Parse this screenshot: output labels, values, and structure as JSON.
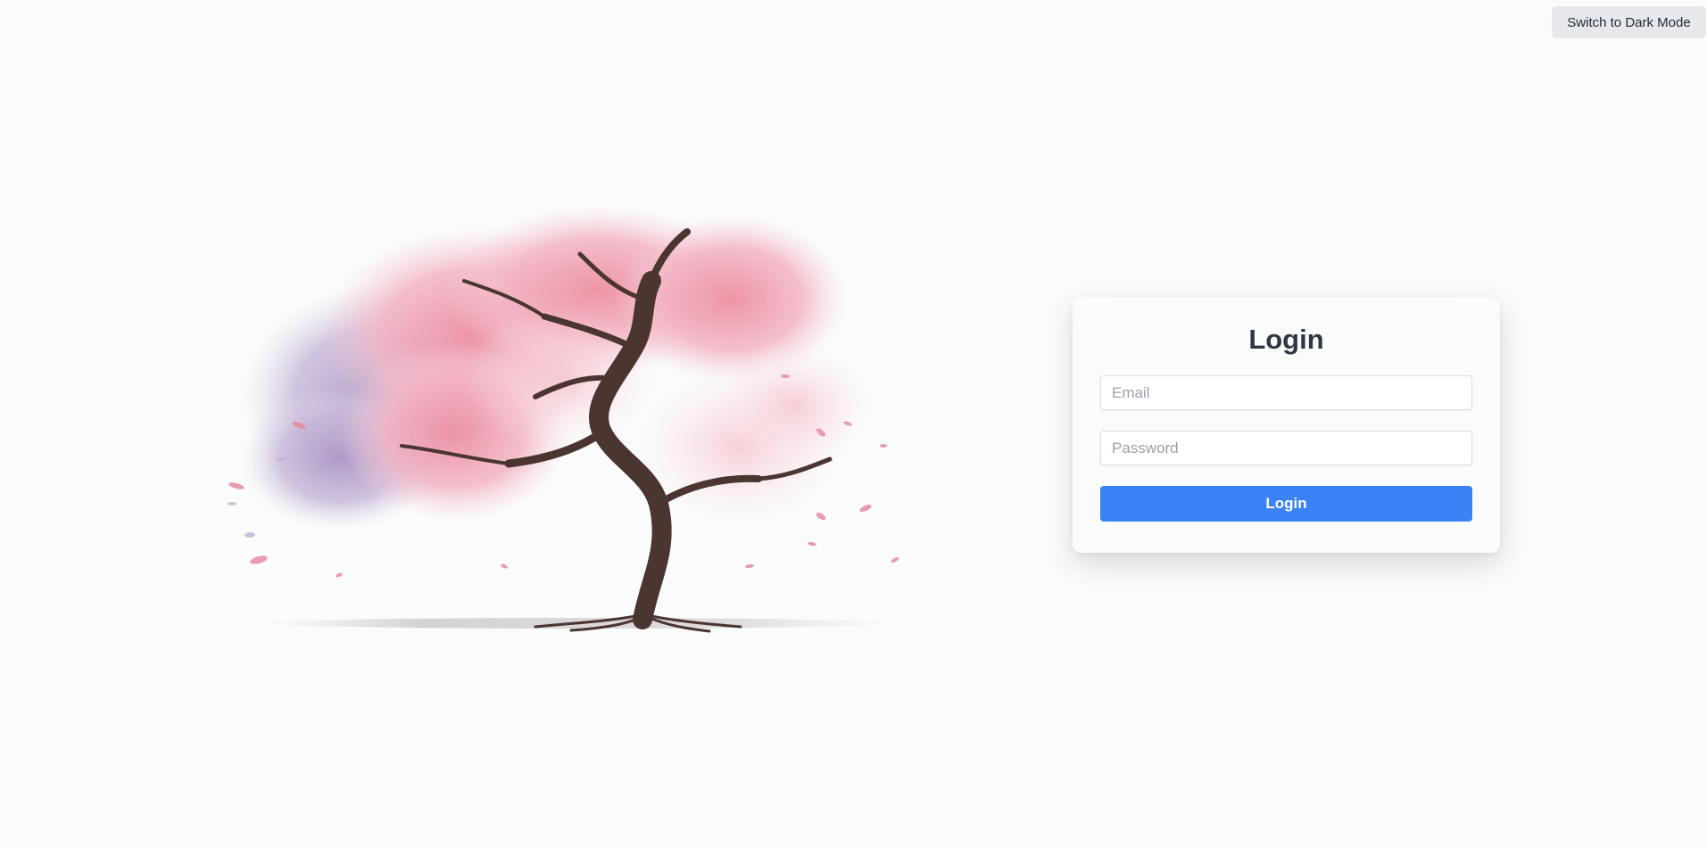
{
  "header": {
    "theme_toggle_label": "Switch to Dark Mode"
  },
  "hero": {
    "image": "cherry-blossom-tree-illustration"
  },
  "login": {
    "title": "Login",
    "email_placeholder": "Email",
    "email_value": "",
    "password_placeholder": "Password",
    "password_value": "",
    "submit_label": "Login"
  },
  "colors": {
    "background": "#fafcfb",
    "accent": "#3b82f6",
    "title_text": "#2d3748",
    "toggle_bg": "#e6e8ec",
    "blossom_pink": "#f3a8b8",
    "blossom_lilac": "#b9a3c9",
    "trunk": "#4a3530"
  }
}
